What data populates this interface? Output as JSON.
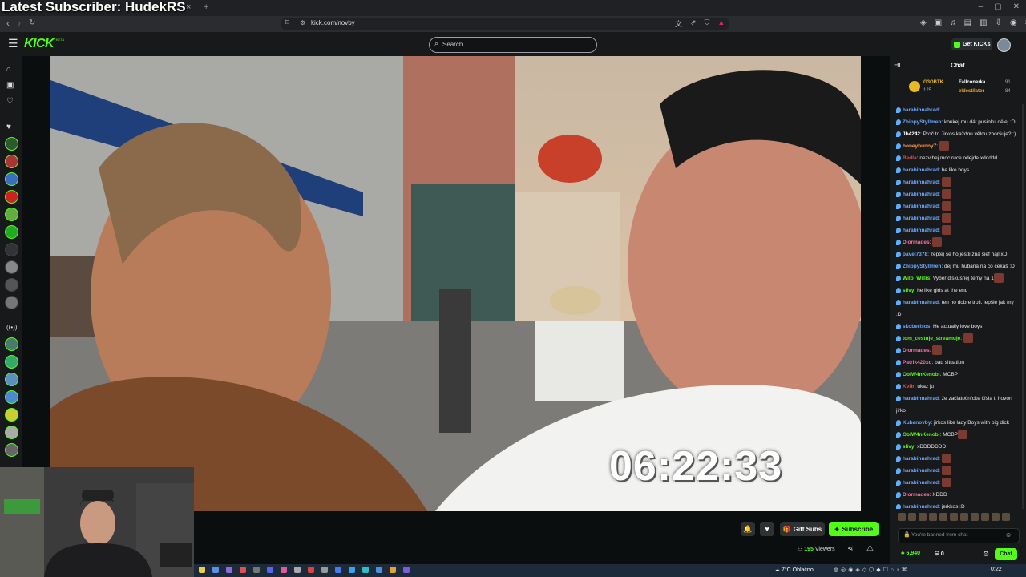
{
  "stream_overlay": {
    "latest_subscriber": "Latest Subscriber: HudekRS"
  },
  "browser": {
    "url": "kick.com/novby",
    "tab_close": "×",
    "tab_new": "+"
  },
  "header": {
    "logo": "KICK",
    "logo_badge": "BETA",
    "search_placeholder": "Search",
    "get_kicks_label": "Get KICKs"
  },
  "video": {
    "timer": "06:22:33"
  },
  "player": {
    "gift_label": "Gift Subs",
    "subscribe_label": "Subscribe",
    "viewers_count": "195",
    "viewers_label": "Viewers"
  },
  "chat": {
    "title": "Chat",
    "leaderboard": [
      {
        "name": "G3OBTK",
        "points": "125"
      },
      {
        "name": "Fallconerka",
        "points": "91"
      },
      {
        "name": "eldestilator",
        "points": "84"
      }
    ],
    "messages": [
      {
        "user": "harabinnahrad",
        "text": ": ",
        "color": "#6ea8ff",
        "emote": false
      },
      {
        "user": "ZhippyStyllmen",
        "text": ": koukej mu dát pusinku dělej :D",
        "color": "#6ea8ff",
        "emote": false
      },
      {
        "user": "Jb4242",
        "text": ": Proč to Jirkos každou větou zhoršuje? :)",
        "color": "#ffffff",
        "emote": false
      },
      {
        "user": "honeybunny7",
        "text": ": ",
        "color": "#ff9a3c",
        "emote": true
      },
      {
        "user": "Bedla",
        "text": ": nezvihej moc ruce odejde xddddd",
        "color": "#e05050",
        "emote": false
      },
      {
        "user": "harabinnahrad",
        "text": ": he like boys",
        "color": "#6ea8ff",
        "emote": false
      },
      {
        "user": "harabinnahrad",
        "text": ": ",
        "color": "#6ea8ff",
        "emote": true
      },
      {
        "user": "harabinnahrad",
        "text": ": ",
        "color": "#6ea8ff",
        "emote": true
      },
      {
        "user": "harabinnahrad",
        "text": ": ",
        "color": "#6ea8ff",
        "emote": true
      },
      {
        "user": "harabinnahrad",
        "text": ": ",
        "color": "#6ea8ff",
        "emote": true
      },
      {
        "user": "harabinnahrad",
        "text": ": ",
        "color": "#6ea8ff",
        "emote": true
      },
      {
        "user": "Diormades",
        "text": ": ",
        "color": "#ff6fa8",
        "emote": true
      },
      {
        "user": "pavel7378",
        "text": ": zeptej se ho jestli zná sief hajl xD",
        "color": "#6ea8ff",
        "emote": false
      },
      {
        "user": "ZhippyStyllmen",
        "text": ": dej mu hubana na co čekáš :D",
        "color": "#6ea8ff",
        "emote": false
      },
      {
        "user": "Wilo_Willis",
        "text": ": Vyber diskusnej temy na 1",
        "color": "#53fc18",
        "emote": true
      },
      {
        "user": "slivy",
        "text": ": he like girls at the end",
        "color": "#53fc18",
        "emote": false
      },
      {
        "user": "harabinnahrad",
        "text": ": ten ho dobre troll. lepšie jak my :D",
        "color": "#6ea8ff",
        "emote": false
      },
      {
        "user": "skoberisos",
        "text": ": He actually love boys",
        "color": "#6ea8ff",
        "emote": false
      },
      {
        "user": "tom_cestuje_streamuje",
        "text": ": ",
        "color": "#53fc18",
        "emote": true
      },
      {
        "user": "Diormades",
        "text": ": ",
        "color": "#ff6fa8",
        "emote": true
      },
      {
        "user": "Patrik420xd",
        "text": ": bad situation",
        "color": "#ff6fa8",
        "emote": false
      },
      {
        "user": "ObiW4nKenobi",
        "text": ": MCBP",
        "color": "#53fc18",
        "emote": false
      },
      {
        "user": "Kefir",
        "text": ": ukaz ju",
        "color": "#e05050",
        "emote": false
      },
      {
        "user": "harabinnahrad",
        "text": ": že začiatočnícke čísla ti hovorí jirko",
        "color": "#6ea8ff",
        "emote": false
      },
      {
        "user": "Kubanovby",
        "text": ": jirkos like lady Boys with big dick",
        "color": "#6ea8ff",
        "emote": false
      },
      {
        "user": "ObiW4nKenobi",
        "text": ": MCBP",
        "color": "#53fc18",
        "emote": true
      },
      {
        "user": "slivy",
        "text": ": xDDDDDDD",
        "color": "#53fc18",
        "emote": false
      },
      {
        "user": "harabinnahrad",
        "text": ": ",
        "color": "#6ea8ff",
        "emote": true
      },
      {
        "user": "harabinnahrad",
        "text": ": ",
        "color": "#6ea8ff",
        "emote": true
      },
      {
        "user": "harabinnahrad",
        "text": ": ",
        "color": "#6ea8ff",
        "emote": true
      },
      {
        "user": "Diormades",
        "text": ": XDDD",
        "color": "#ff6fa8",
        "emote": false
      },
      {
        "user": "harabinnahrad",
        "text": ": jerkkos :D",
        "color": "#6ea8ff",
        "emote": false
      }
    ],
    "input_placeholder": "You're banned from chat",
    "points": "6,940",
    "points_b": "0",
    "send_label": "Chat"
  },
  "taskbar": {
    "weather": "7°C  Oblačno",
    "time": "0:22"
  },
  "colors": {
    "kick_green": "#53fc18",
    "bg": "#0b0e0f",
    "panel": "#18191b"
  },
  "icons": [
    "menu-icon",
    "search-icon",
    "home-icon",
    "browse-icon",
    "following-icon",
    "bell-icon",
    "heart-icon",
    "gift-icon",
    "share-icon",
    "report-icon",
    "lock-icon",
    "emoji-icon",
    "gear-icon"
  ]
}
